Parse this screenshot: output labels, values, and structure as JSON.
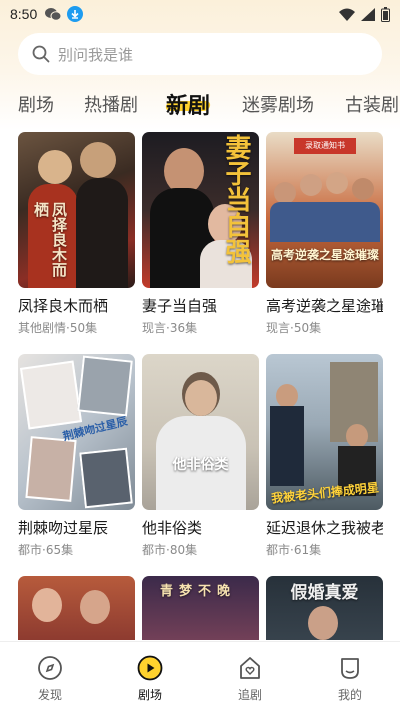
{
  "status_bar": {
    "time": "8:50",
    "left_icons": [
      "wechat-icon",
      "download-icon"
    ],
    "right_icons": [
      "wifi-icon",
      "signal-icon",
      "battery-icon"
    ]
  },
  "search": {
    "icon": "search-icon",
    "placeholder": "别问我是谁"
  },
  "tabs": [
    {
      "label": "剧场",
      "active": false
    },
    {
      "label": "热播剧",
      "active": false
    },
    {
      "label": "新剧",
      "active": true
    },
    {
      "label": "迷雾剧场",
      "active": false
    },
    {
      "label": "古装剧",
      "active": false
    }
  ],
  "dramas": [
    {
      "title": "凤择良木而栖",
      "meta": "其他剧情·50集",
      "poster_text": "凤择良木而栖"
    },
    {
      "title": "妻子当自强",
      "meta": "现言·36集",
      "poster_text": "妻子当自强"
    },
    {
      "title": "高考逆袭之星途璀璨",
      "meta": "现言·50集",
      "poster_text": "高考逆袭之星途璀璨",
      "poster_tag": "录取通知书"
    },
    {
      "title": "荆棘吻过星辰",
      "meta": "都市·65集",
      "poster_text": "荆棘吻过星辰"
    },
    {
      "title": "他非俗类",
      "meta": "都市·80集",
      "poster_text": "他非俗类"
    },
    {
      "title": "延迟退休之我被老头们捧成明星",
      "meta": "都市·61集",
      "poster_text": "我被老头们捧成明星"
    },
    {
      "title": "",
      "meta": "",
      "poster_text": ""
    },
    {
      "title": "",
      "meta": "",
      "poster_text": "青梦不晚"
    },
    {
      "title": "",
      "meta": "",
      "poster_text": "假婚真爱"
    }
  ],
  "bottom_nav": [
    {
      "label": "发现",
      "icon": "compass-icon",
      "active": false
    },
    {
      "label": "剧场",
      "icon": "play-icon",
      "active": true
    },
    {
      "label": "追剧",
      "icon": "heart-house-icon",
      "active": false
    },
    {
      "label": "我的",
      "icon": "profile-icon",
      "active": false
    }
  ],
  "colors": {
    "accent": "#ffd22e",
    "header_bg": "#fbf0da",
    "search_bg": "#ffffff"
  }
}
